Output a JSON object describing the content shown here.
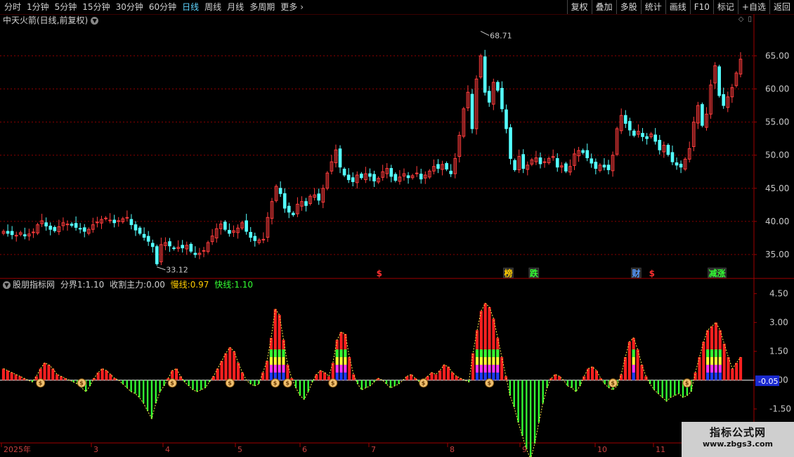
{
  "toolbar": {
    "periods": [
      "分时",
      "1分钟",
      "5分钟",
      "15分钟",
      "30分钟",
      "60分钟",
      "日线",
      "周线",
      "月线",
      "多周期",
      "更多"
    ],
    "active_period": "日线",
    "buttons": [
      "复权",
      "叠加",
      "多股",
      "统计",
      "画线",
      "F10",
      "标记",
      "+自选",
      "返回"
    ]
  },
  "chart_title": "中天火箭(日线,前复权)",
  "indicator": {
    "name": "股朋指标网",
    "field1_label": "分界1:",
    "field1_value": "1.10",
    "field2_label": "收割主力:",
    "field2_value": "0.00",
    "field3_label": "慢线:",
    "field3_value": "0.97",
    "field4_label": "快线:",
    "field4_value": "1.10",
    "current_value_badge": "-0.05"
  },
  "markers": [
    {
      "text": "$",
      "color": "#ff3030"
    },
    {
      "text": "榜",
      "color": "#ffcc00"
    },
    {
      "text": "跌",
      "color": "#33ff33"
    },
    {
      "text": "财",
      "color": "#5599ff"
    },
    {
      "text": "$",
      "color": "#ff3030"
    },
    {
      "text": "减涨",
      "color": "#33ff33"
    }
  ],
  "price_high_label": "68.71",
  "price_low_label": "33.12",
  "x_axis": [
    "2025年",
    "3",
    "4",
    "5",
    "6",
    "7",
    "8",
    "9",
    "10",
    "11"
  ],
  "watermark": {
    "line1": "指标公式网",
    "line2": "www.zbgs3.com"
  },
  "chart_data": {
    "type": "candlestick",
    "title": "中天火箭(日线,前复权)",
    "y_ticks_price": [
      "65.00",
      "60.00",
      "55.00",
      "50.00",
      "45.00",
      "40.00",
      "35.00"
    ],
    "y_ticks_indicator": [
      "4.50",
      "3.00",
      "1.50",
      "0.00",
      "-1.50"
    ],
    "price_max": 68.71,
    "price_min": 33.12,
    "close": [
      38.5,
      38.2,
      38.0,
      37.9,
      38.3,
      37.8,
      38.1,
      38.4,
      39.5,
      40.1,
      39.3,
      38.8,
      38.6,
      39.2,
      39.8,
      39.6,
      39.4,
      39.1,
      38.9,
      38.5,
      38.8,
      39.5,
      39.9,
      40.3,
      40.5,
      40.2,
      39.8,
      40.1,
      40.4,
      40.6,
      39.5,
      38.7,
      38.2,
      37.6,
      37.0,
      36.2,
      33.6,
      36.5,
      36.8,
      36.3,
      35.9,
      36.1,
      36.0,
      36.4,
      35.5,
      35.0,
      35.2,
      35.6,
      36.8,
      37.8,
      38.9,
      39.6,
      38.8,
      38.2,
      38.6,
      39.0,
      39.8,
      38.5,
      37.6,
      37.1,
      37.2,
      37.3,
      40.6,
      43.0,
      45.3,
      44.2,
      42.0,
      41.4,
      41.0,
      42.6,
      43.0,
      42.4,
      43.8,
      44.0,
      43.2,
      45.0,
      47.3,
      49.0,
      50.8,
      48.2,
      47.0,
      46.3,
      46.0,
      47.0,
      46.6,
      47.2,
      46.8,
      46.1,
      46.5,
      47.5,
      48.0,
      46.8,
      46.2,
      46.7,
      47.2,
      46.6,
      46.9,
      47.3,
      46.4,
      47.0,
      47.6,
      48.3,
      48.0,
      48.6,
      47.9,
      47.2,
      49.5,
      53.0,
      57.0,
      59.5,
      54.0,
      61.5,
      65.0,
      59.5,
      58.0,
      61.0,
      59.8,
      57.0,
      54.0,
      49.5,
      47.8,
      49.8,
      48.0,
      48.5,
      49.3,
      49.6,
      48.7,
      49.0,
      49.5,
      49.8,
      48.2,
      48.4,
      47.6,
      48.3,
      50.2,
      50.7,
      50.4,
      49.6,
      48.8,
      48.0,
      48.5,
      48.2,
      47.8,
      50.0,
      54.0,
      56.0,
      54.8,
      53.8,
      53.0,
      53.6,
      52.8,
      52.5,
      53.2,
      52.1,
      50.8,
      51.5,
      50.1,
      49.0,
      48.5,
      48.2,
      49.4,
      51.0,
      55.0,
      57.5,
      54.5,
      56.2,
      60.6,
      63.5,
      59.0,
      57.5,
      58.8,
      60.2,
      62.4,
      64.5
    ],
    "indicator_series": [
      {
        "name": "快线",
        "values": [
          0.6,
          0.5,
          0.4,
          0.3,
          0.2,
          0.1,
          0.0,
          -0.1,
          0.2,
          0.6,
          0.9,
          0.8,
          0.6,
          0.3,
          0.2,
          0.1,
          0.0,
          -0.1,
          -0.2,
          -0.4,
          -0.6,
          -0.3,
          0.1,
          0.4,
          0.6,
          0.5,
          0.3,
          0.1,
          0.0,
          -0.2,
          -0.4,
          -0.6,
          -0.7,
          -0.9,
          -1.2,
          -1.6,
          -2.0,
          -1.2,
          -0.6,
          -0.3,
          0.1,
          0.5,
          0.6,
          0.2,
          -0.1,
          -0.3,
          -0.5,
          -0.6,
          -0.5,
          -0.4,
          -0.1,
          0.2,
          0.6,
          1.0,
          1.4,
          1.7,
          1.5,
          0.9,
          0.4,
          0.0,
          -0.2,
          -0.3,
          -0.2,
          0.4,
          1.0,
          2.2,
          3.7,
          3.4,
          2.1,
          0.8,
          0.1,
          -0.4,
          -0.8,
          -1.0,
          -0.6,
          -0.1,
          0.3,
          0.5,
          0.4,
          0.2,
          0.9,
          2.1,
          2.5,
          2.4,
          1.2,
          0.3,
          -0.2,
          -0.5,
          -0.4,
          -0.3,
          -0.1,
          0.1,
          0.0,
          -0.2,
          -0.4,
          -0.3,
          -0.2,
          0.0,
          0.2,
          0.3,
          0.1,
          -0.1,
          0.0,
          0.2,
          0.4,
          0.3,
          0.5,
          0.8,
          0.7,
          0.4,
          0.2,
          0.1,
          0.0,
          -0.1,
          1.4,
          2.6,
          3.6,
          4.0,
          3.8,
          3.2,
          2.2,
          1.2,
          0.2,
          -0.8,
          -1.4,
          -2.2,
          -2.9,
          -3.6,
          -4.1,
          -3.3,
          -2.2,
          -1.2,
          -0.4,
          0.1,
          0.3,
          0.2,
          0.0,
          -0.3,
          -0.4,
          -0.6,
          -0.3,
          0.2,
          0.6,
          0.7,
          0.5,
          0.1,
          -0.2,
          -0.4,
          -0.5,
          -0.3,
          0.3,
          1.2,
          2.0,
          2.2,
          1.6,
          0.8,
          0.2,
          -0.2,
          -0.5,
          -0.7,
          -0.9,
          -1.1,
          -0.9,
          -0.8,
          -0.7,
          -0.9,
          -0.8,
          -0.6,
          0.4,
          1.2,
          2.0,
          2.6,
          2.8,
          3.0,
          2.6,
          1.9,
          1.2,
          0.6,
          0.9,
          1.2
        ]
      }
    ]
  }
}
